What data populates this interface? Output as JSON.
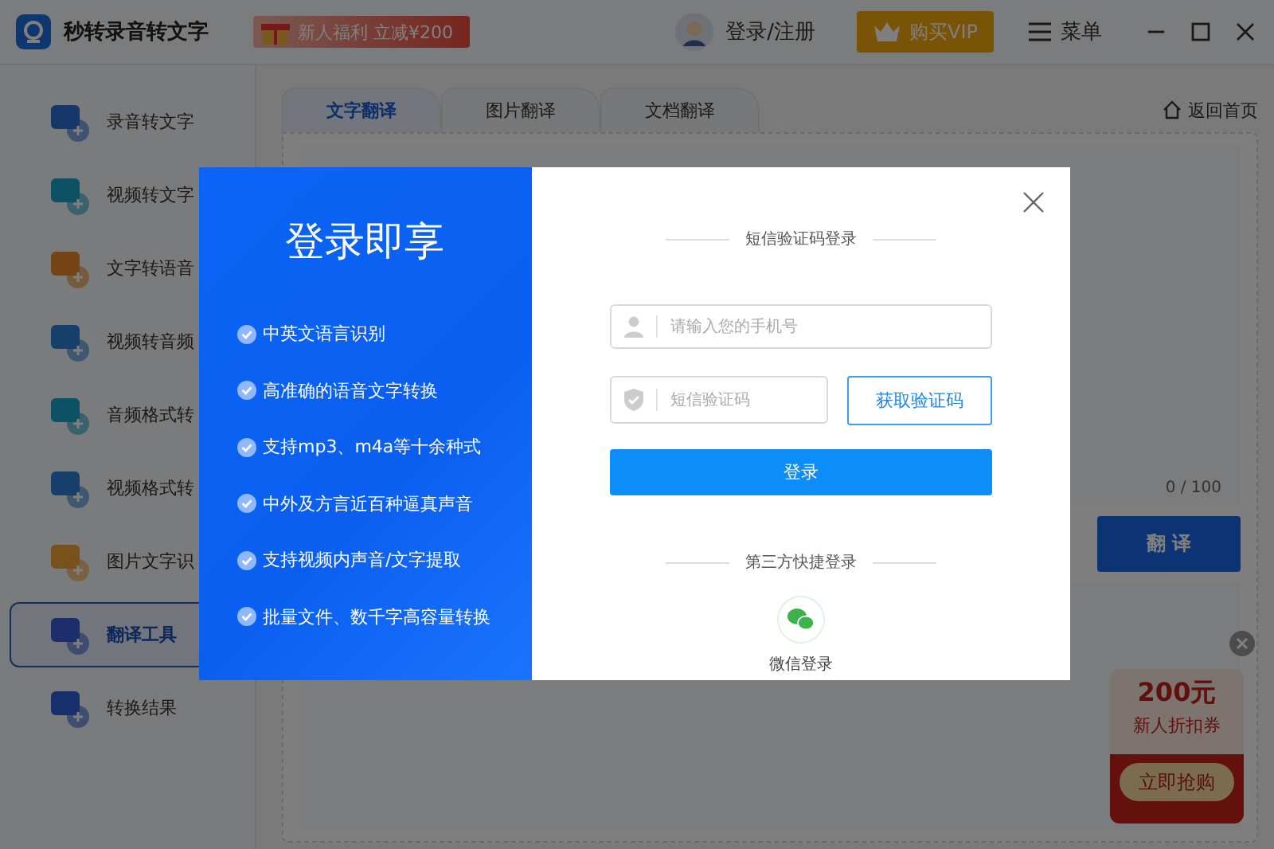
{
  "app": {
    "title": "秒转录音转文字",
    "promo": "新人福利 立减¥200",
    "login_link": "登录/注册",
    "vip_button": "购买VIP",
    "menu": "菜单"
  },
  "sidebar": {
    "items": [
      {
        "label": "录音转文字",
        "selected": false
      },
      {
        "label": "视频转文字",
        "selected": false
      },
      {
        "label": "文字转语音",
        "selected": false
      },
      {
        "label": "视频转音频",
        "selected": false
      },
      {
        "label": "音频格式转",
        "selected": false
      },
      {
        "label": "视频格式转",
        "selected": false
      },
      {
        "label": "图片文字识",
        "selected": false
      },
      {
        "label": "翻译工具",
        "selected": true
      },
      {
        "label": "转换结果",
        "selected": false
      }
    ]
  },
  "tabs": [
    {
      "label": "文字翻译",
      "selected": true
    },
    {
      "label": "图片翻译",
      "selected": false
    },
    {
      "label": "文档翻译",
      "selected": false
    }
  ],
  "back_link": "返回首页",
  "editor": {
    "counter": "0 / 100",
    "translate_button": "翻 译"
  },
  "coupon": {
    "amount": "200元",
    "subtitle": "新人折扣券",
    "button": "立即抢购"
  },
  "login_modal": {
    "headline": "登录即享",
    "features": [
      "中英文语言识别",
      "高准确的语音文字转换",
      "支持mp3、m4a等十余种式",
      "中外及方言近百种逼真声音",
      "支持视频内声音/文字提取",
      "批量文件、数千字高容量转换"
    ],
    "section_title": "短信验证码登录",
    "phone": {
      "placeholder": "请输入您的手机号"
    },
    "code": {
      "placeholder": "短信验证码"
    },
    "get_code_button": "获取验证码",
    "submit_button": "登录",
    "third_party_title": "第三方快捷登录",
    "wechat_label": "微信登录"
  }
}
